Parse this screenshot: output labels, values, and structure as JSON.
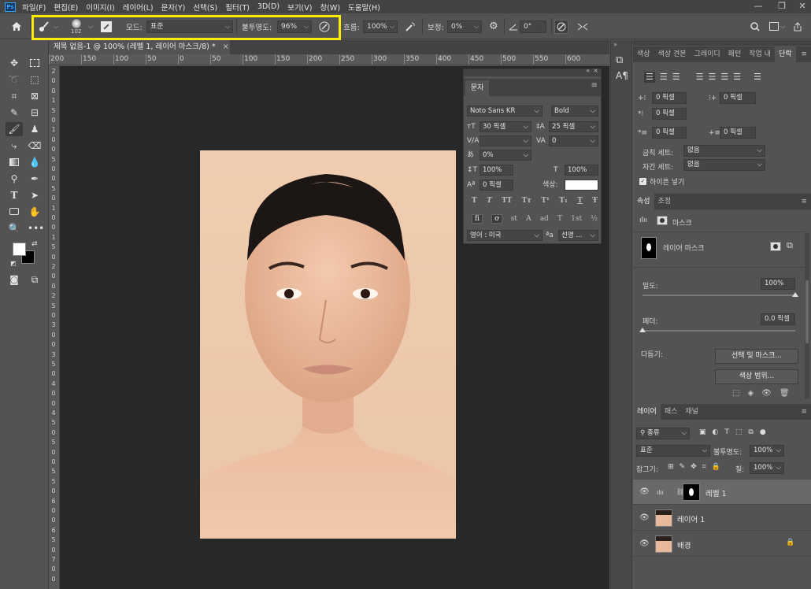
{
  "app": {
    "logo": "Ps",
    "menu": [
      "파일(F)",
      "편집(E)",
      "이미지(I)",
      "레이어(L)",
      "문자(Y)",
      "선택(S)",
      "필터(T)",
      "3D(D)",
      "보기(V)",
      "창(W)",
      "도움말(H)"
    ]
  },
  "options": {
    "brush_size": "102",
    "mode_label": "모드:",
    "mode_value": "표준",
    "opacity_label": "불투명도:",
    "opacity_value": "96%",
    "flow_label": "흐름:",
    "flow_value": "100%",
    "smoothing_label": "보정:",
    "smoothing_value": "0%",
    "angle_value": "0°"
  },
  "document": {
    "tab_title": "제목 없음-1 @ 100% (레벨 1, 레이어 마스크/8) *"
  },
  "ruler": {
    "h_labels": [
      "200",
      "150",
      "100",
      "50",
      "0",
      "50",
      "100",
      "150",
      "200",
      "250",
      "300",
      "350",
      "400",
      "450",
      "500",
      "550",
      "600"
    ],
    "v_labels": [
      "2",
      "0",
      "0",
      "1",
      "5",
      "0",
      "1",
      "0",
      "0",
      "5",
      "0",
      "0",
      "5",
      "0",
      "1",
      "0",
      "0",
      "1",
      "5",
      "0",
      "2",
      "0",
      "0",
      "2",
      "5",
      "0",
      "3",
      "0",
      "0",
      "3",
      "5",
      "0",
      "4",
      "0",
      "0",
      "4",
      "5",
      "0",
      "5",
      "0",
      "0",
      "5",
      "5",
      "0",
      "6",
      "0",
      "0",
      "6",
      "5",
      "0",
      "7",
      "0",
      "0"
    ]
  },
  "char_panel": {
    "title": "문자",
    "font_family": "Noto Sans KR",
    "font_style": "Bold",
    "font_size": "30 픽셀",
    "leading": "25 픽셀",
    "kerning": "",
    "tracking": "0",
    "tsume": "0%",
    "vscale": "100%",
    "hscale": "100%",
    "baseline": "0 픽셀",
    "color_label": "색상:",
    "styles": [
      "T",
      "T",
      "TT",
      "Tт",
      "T¹",
      "T₁",
      "T",
      "Ŧ"
    ],
    "opentype": [
      "fi",
      "ơ",
      "st",
      "A",
      "ad",
      "T",
      "1st",
      "½"
    ],
    "language": "영어 : 미국",
    "aa_label": "ªa",
    "aa_value": "선명 ..."
  },
  "paragraph_panel": {
    "tabs": [
      "색상",
      "색상 견본",
      "그레이디",
      "패턴",
      "작업 내",
      "단락"
    ],
    "active_tab": "단락",
    "indent_left": "0 픽셀",
    "indent_right": "0 픽셀",
    "indent_first": "0 픽셀",
    "space_before": "0 픽셀",
    "space_after": "0 픽셀",
    "kinsoku_label": "금칙 세트:",
    "kinsoku_value": "없음",
    "mojikumi_label": "자간 세트:",
    "mojikumi_value": "없음",
    "hyphenate_label": "하이픈 넣기"
  },
  "properties_panel": {
    "tabs": [
      "속성",
      "조정"
    ],
    "active_tab": "속성",
    "section_label": "마스크",
    "layer_mask_label": "레이어 마스크",
    "density_label": "밀도:",
    "density_value": "100%",
    "density_level": 1.0,
    "feather_label": "페더:",
    "feather_value": "0.0 픽셀",
    "feather_level": 0.0,
    "refine_label": "다듬기:",
    "select_mask_button": "선택 및 마스크...",
    "color_range_button": "색상 범위..."
  },
  "layers_panel": {
    "tabs": [
      "레이어",
      "패스",
      "채널"
    ],
    "active_tab": "레이어",
    "filter_kind": "종류",
    "blend_mode": "표준",
    "opacity_label": "불투명도:",
    "opacity_value": "100%",
    "lock_label": "잠그기:",
    "fill_label": "칠:",
    "fill_value": "100%",
    "layers": [
      {
        "name": "레벨 1",
        "selected": true
      },
      {
        "name": "레이어 1",
        "selected": false
      },
      {
        "name": "배경",
        "selected": false
      }
    ]
  },
  "colors": {
    "accent": "#31a8ff",
    "highlight": "#ffeb00",
    "panel_bg": "#535353",
    "canvas_bg": "#282828"
  }
}
